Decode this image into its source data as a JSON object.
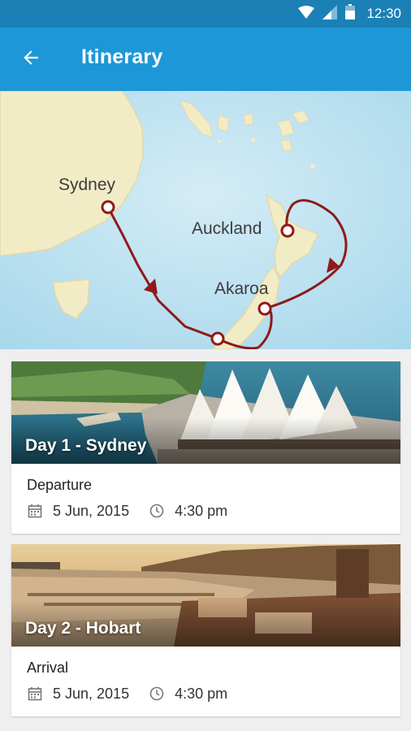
{
  "status_bar": {
    "time": "12:30",
    "icons": [
      "wifi-icon",
      "signal-icon",
      "battery-icon"
    ]
  },
  "app_bar": {
    "title": "Itinerary",
    "back_icon": "arrow-back-icon"
  },
  "map": {
    "ports": [
      {
        "name": "Sydney"
      },
      {
        "name": "Auckland"
      },
      {
        "name": "Akaroa"
      }
    ],
    "route_color": "#8e1a1a"
  },
  "colors": {
    "status_bar": "#1a80b6",
    "app_bar": "#1d97d8",
    "sea": "#bfe3f1",
    "land": "#f2ecc6"
  },
  "itinerary": [
    {
      "day": "Day 1 - Sydney",
      "status": "Departure",
      "date": "5 Jun, 2015",
      "time": "4:30 pm"
    },
    {
      "day": "Day 2 - Hobart",
      "status": "Arrival",
      "date": "5 Jun, 2015",
      "time": "4:30 pm"
    }
  ]
}
